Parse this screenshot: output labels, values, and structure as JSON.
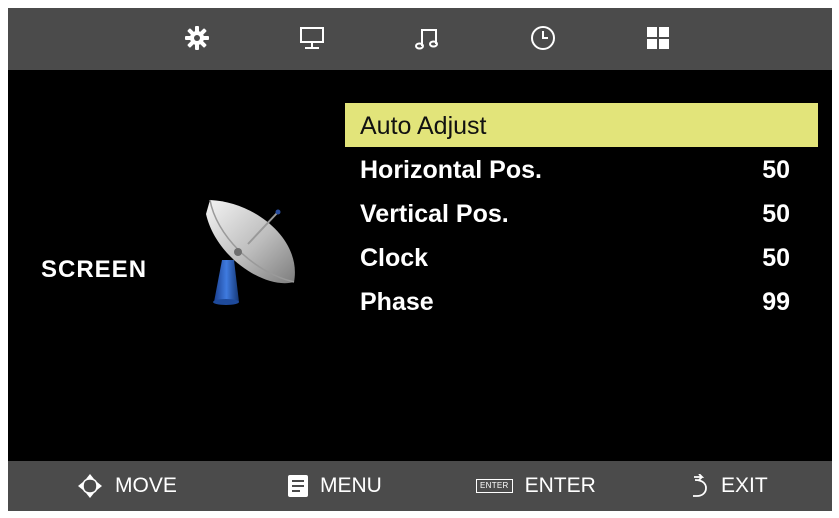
{
  "tabs": [
    {
      "icon": "gear-sun-icon",
      "active": true
    },
    {
      "icon": "monitor-icon"
    },
    {
      "icon": "music-note-icon"
    },
    {
      "icon": "clock-icon"
    },
    {
      "icon": "grid-icon"
    }
  ],
  "section": {
    "title": "SCREEN",
    "icon": "satellite-dish-icon"
  },
  "menu": {
    "items": [
      {
        "label": "Auto Adjust",
        "value": "",
        "selected": true
      },
      {
        "label": "Horizontal Pos.",
        "value": "50"
      },
      {
        "label": "Vertical Pos.",
        "value": "50"
      },
      {
        "label": "Clock",
        "value": "50"
      },
      {
        "label": "Phase",
        "value": "99"
      }
    ]
  },
  "footer": {
    "move": "MOVE",
    "menu": "MENU",
    "enter_icon_text": "ENTER",
    "enter": "ENTER",
    "exit": "EXIT"
  },
  "colors": {
    "bar_bg": "#4b4b4b",
    "panel_bg": "#000000",
    "highlight": "#e2e47a"
  }
}
